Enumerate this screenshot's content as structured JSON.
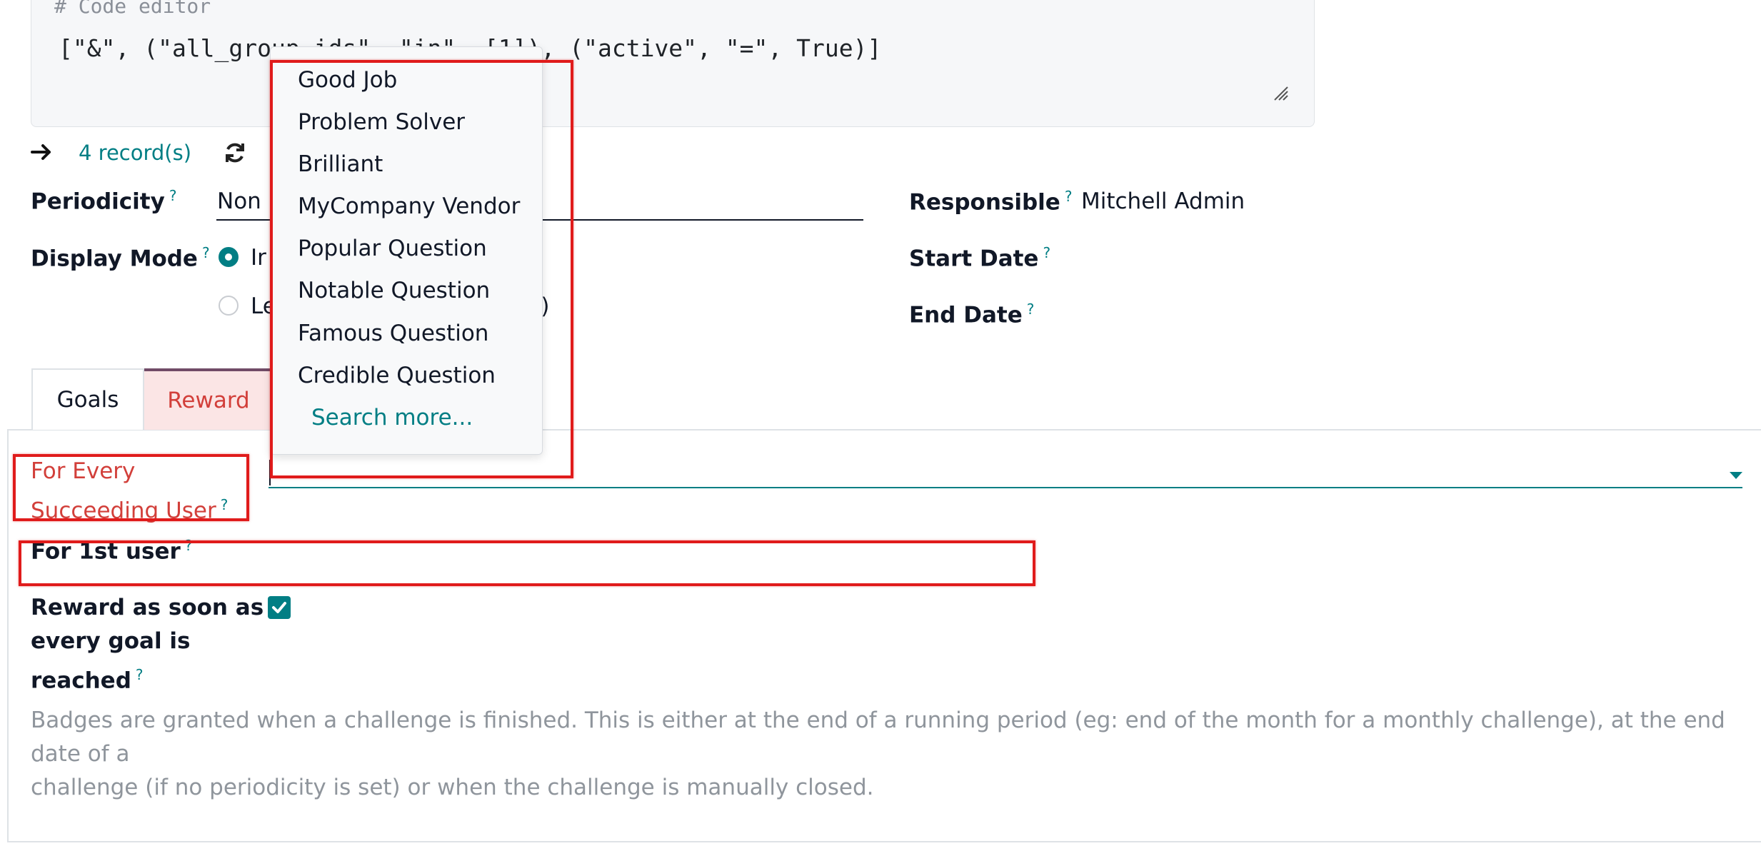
{
  "code_editor": {
    "comment": "# Code editor",
    "domain": "[\"&\", (\"all_group_ids\", \"in\", [1]), (\"active\", \"=\", True)]"
  },
  "records": {
    "label": "4 record(s)"
  },
  "fields": {
    "periodicity": {
      "label": "Periodicity",
      "help": "?",
      "value": "Non"
    },
    "display_mode": {
      "label": "Display Mode",
      "help": "?",
      "options": [
        "Ir",
        "Le"
      ],
      "option_tail": "ng)",
      "selected": 0
    },
    "responsible": {
      "label": "Responsible",
      "help": "?",
      "value": "Mitchell Admin"
    },
    "start_date": {
      "label": "Start Date",
      "help": "?"
    },
    "end_date": {
      "label": "End Date",
      "help": "?"
    }
  },
  "tabs": [
    {
      "label": "Goals",
      "active": false
    },
    {
      "label": "Reward",
      "active": true
    }
  ],
  "reward": {
    "every_user_label_1": "For Every",
    "every_user_label_2": "Succeeding User",
    "every_user_help": "?",
    "first_user_label": "For 1st user",
    "first_user_help": "?",
    "asap_label_1": "Reward as soon as",
    "asap_label_2": "every goal is",
    "asap_label_3": "reached",
    "asap_help": "?",
    "asap_checked": true,
    "help_text_1": "Badges are granted when a challenge is finished. This is either at the end of a running period (eg: end of the month for a monthly challenge), at the end date of a",
    "help_text_2": "challenge (if no periodicity is set) or when the challenge is manually closed."
  },
  "dropdown": {
    "items": [
      "Good Job",
      "Problem Solver",
      "Brilliant",
      "MyCompany Vendor",
      "Popular Question",
      "Notable Question",
      "Famous Question",
      "Credible Question"
    ],
    "search_more": "Search more..."
  },
  "colors": {
    "accent": "#017e84",
    "required_red": "#d23f3a",
    "annotation_red": "#e01b1b",
    "tab_top": "#714b67"
  }
}
